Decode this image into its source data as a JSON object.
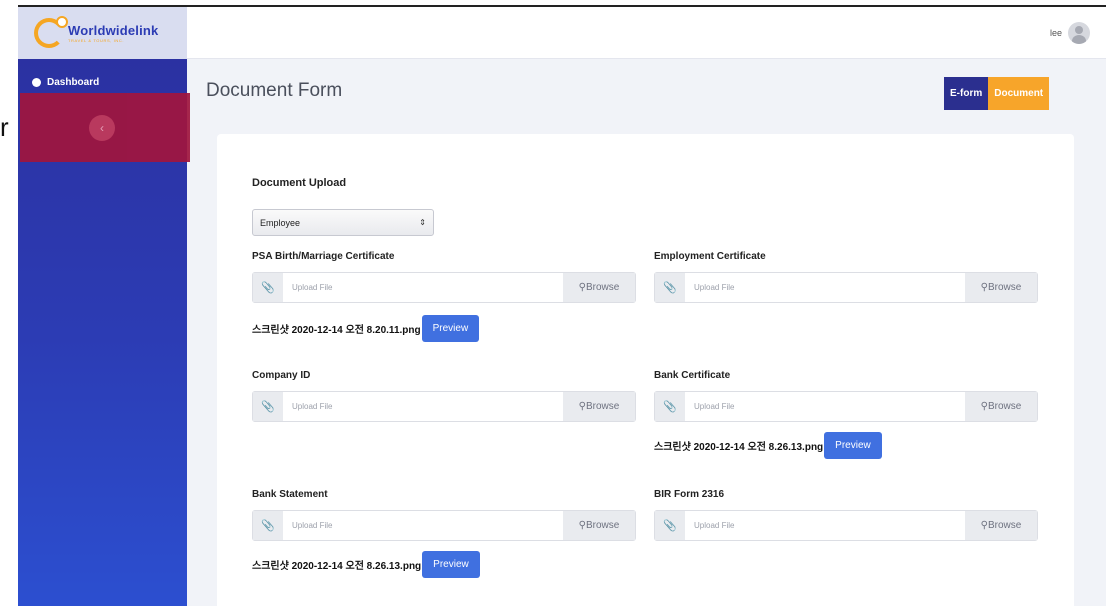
{
  "stray_text": "r",
  "logo": {
    "name": "Worldwidelink",
    "sub": "TRAVEL & TOURS, INC."
  },
  "sidebar": {
    "items": [
      {
        "label": "Dashboard",
        "icon": "dashboard-icon"
      }
    ],
    "collapse_glyph": "‹"
  },
  "topbar": {
    "user_name": "lee"
  },
  "page": {
    "title": "Document Form"
  },
  "toggle": {
    "eform_label": "E-form",
    "document_label": "Document",
    "active": "Document"
  },
  "form": {
    "section_title": "Document Upload",
    "select": {
      "value": "Employee",
      "arrows": "⇕"
    },
    "fields": {
      "psa": {
        "label": "PSA Birth/Marriage Certificate",
        "placeholder": "Upload File",
        "browse": "Browse",
        "file": "스크린샷 2020-12-14 오전 8.20.11.png",
        "preview": "Preview"
      },
      "employment": {
        "label": "Employment Certificate",
        "placeholder": "Upload File",
        "browse": "Browse"
      },
      "company_id": {
        "label": "Company ID",
        "placeholder": "Upload File",
        "browse": "Browse"
      },
      "bank_cert": {
        "label": "Bank Certificate",
        "placeholder": "Upload File",
        "browse": "Browse",
        "file": "스크린샷 2020-12-14 오전 8.26.13.png",
        "preview": "Preview"
      },
      "bank_statement": {
        "label": "Bank Statement",
        "placeholder": "Upload File",
        "browse": "Browse",
        "file": "스크린샷 2020-12-14 오전 8.26.13.png",
        "preview": "Preview"
      },
      "bir": {
        "label": "BIR Form 2316",
        "placeholder": "Upload File",
        "browse": "Browse"
      }
    }
  },
  "colors": {
    "sidebar": "#2c3cb4",
    "accent_orange": "#f7a52a",
    "eform_bg": "#2b2f8f",
    "preview_blue": "#4070e0",
    "highlight_red": "#a0153e"
  }
}
